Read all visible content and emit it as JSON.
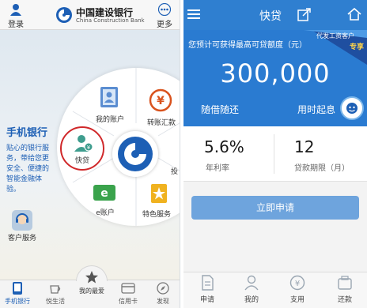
{
  "left": {
    "topbar": {
      "login": "登录",
      "bank_cn": "中国建设银行",
      "bank_en": "China Construction Bank",
      "more": "更多"
    },
    "side": {
      "title": "手机银行",
      "desc": [
        "贴心的银行服",
        "务，带给您更",
        "安全、便捷的",
        "智能金融体",
        "验。"
      ],
      "customer_service": "客户服务"
    },
    "wheel": {
      "items": [
        {
          "label": "我的账户"
        },
        {
          "label": "转账汇款"
        },
        {
          "label": "快贷"
        },
        {
          "label": "e账户"
        },
        {
          "label": "特色服务"
        },
        {
          "label": "投"
        }
      ]
    },
    "bottom_nav": [
      {
        "label": "手机银行"
      },
      {
        "label": "悦生活"
      },
      {
        "label": "我的最爱"
      },
      {
        "label": "信用卡"
      },
      {
        "label": "发现"
      }
    ]
  },
  "right": {
    "header": {
      "title": "快贷"
    },
    "hero": {
      "line": "您预计可获得最高可贷额度（元）",
      "corner_line1": "代发工资客户",
      "corner_line2": "专享",
      "amount": "300,000",
      "tag1": "随借随还",
      "tag2": "用时起息"
    },
    "stats": [
      {
        "value": "5.6%",
        "label": "年利率"
      },
      {
        "value": "12",
        "label": "贷款期限（月）"
      }
    ],
    "apply_button": "立即申请",
    "bottom_nav": [
      {
        "label": "申请"
      },
      {
        "label": "我的"
      },
      {
        "label": "支用"
      },
      {
        "label": "还款"
      }
    ]
  },
  "colors": {
    "ccb_blue": "#1d5fb5",
    "hero_blue": "#2a7bd1",
    "accent_red": "#d0282a",
    "button_blue": "#6ea4dd"
  }
}
